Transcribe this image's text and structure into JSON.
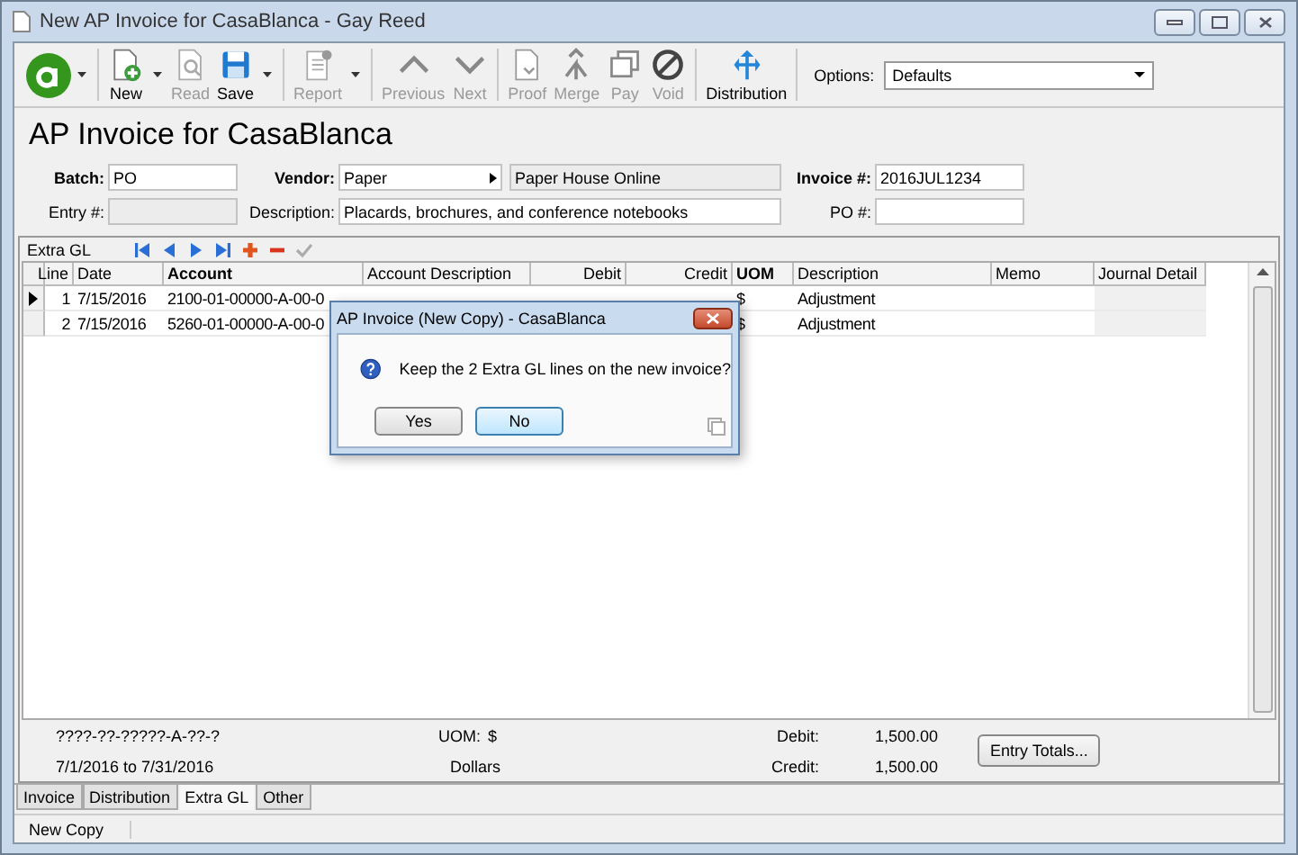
{
  "window": {
    "title": "New AP Invoice for CasaBlanca - Gay Reed"
  },
  "toolbar": {
    "groups": [
      {
        "items": [
          {
            "kind": "logo",
            "disabled": false,
            "menu": true
          }
        ]
      },
      {
        "items": [
          {
            "kind": "button",
            "label": "New",
            "disabled": false,
            "menu": true
          },
          {
            "kind": "button",
            "label": "Read",
            "disabled": true,
            "menu": false
          },
          {
            "kind": "button",
            "label": "Save",
            "disabled": false,
            "menu": true
          }
        ]
      },
      {
        "items": [
          {
            "kind": "button",
            "label": "Report",
            "disabled": true,
            "menu": true
          }
        ]
      },
      {
        "items": [
          {
            "kind": "button",
            "label": "Previous",
            "disabled": true,
            "menu": false
          },
          {
            "kind": "button",
            "label": "Next",
            "disabled": true,
            "menu": false
          }
        ]
      },
      {
        "items": [
          {
            "kind": "button",
            "label": "Proof",
            "disabled": true,
            "menu": false
          },
          {
            "kind": "button",
            "label": "Merge",
            "disabled": true,
            "menu": false
          },
          {
            "kind": "button",
            "label": "Pay",
            "disabled": true,
            "menu": false
          },
          {
            "kind": "button",
            "label": "Void",
            "disabled": true,
            "menu": false
          }
        ]
      },
      {
        "items": [
          {
            "kind": "button",
            "label": "Distribution",
            "disabled": false,
            "menu": false
          }
        ]
      }
    ],
    "options": {
      "label": "Options:",
      "value": "Defaults"
    }
  },
  "heading": "AP Invoice for CasaBlanca",
  "fields": {
    "batch": {
      "label": "Batch:",
      "value": "PO"
    },
    "vendor": {
      "label": "Vendor:",
      "value": "Paper",
      "name": "Paper House Online"
    },
    "invoice": {
      "label": "Invoice #:",
      "value": "2016JUL1234"
    },
    "entry": {
      "label": "Entry #:"
    },
    "description": {
      "label": "Description:",
      "value": "Placards, brochures, and conference notebooks"
    },
    "po": {
      "label": "PO #:"
    }
  },
  "extra_gl": {
    "label": "Extra GL",
    "nav_disabled": [
      false,
      false,
      false,
      false,
      false,
      false,
      true
    ]
  },
  "table": {
    "columns": [
      {
        "label": "Line",
        "bold": false,
        "kind": "number"
      },
      {
        "label": "Date",
        "bold": false,
        "kind": "text"
      },
      {
        "label": "Account",
        "bold": true,
        "kind": "text"
      },
      {
        "label": "Account Description",
        "bold": false,
        "kind": "text"
      },
      {
        "label": "Debit",
        "bold": false,
        "kind": "number"
      },
      {
        "label": "Credit",
        "bold": false,
        "kind": "number"
      },
      {
        "label": "UOM",
        "bold": true,
        "kind": "text"
      },
      {
        "label": "Description",
        "bold": false,
        "kind": "text"
      },
      {
        "label": "Memo",
        "bold": false,
        "kind": "text"
      },
      {
        "label": "Journal Detail",
        "bold": false,
        "kind": "readonly"
      }
    ],
    "rows": [
      {
        "selected": true,
        "line": "1",
        "date": "7/15/2016",
        "account": "2100-01-00000-A-00-0",
        "uom": "$",
        "description": "Adjustment"
      },
      {
        "selected": false,
        "line": "2",
        "date": "7/15/2016",
        "account": "5260-01-00000-A-00-0",
        "uom": "$",
        "description": "Adjustment"
      }
    ]
  },
  "footer": {
    "account_mask": "????-??-?????-A-??-?",
    "period": "7/1/2016 to 7/31/2016",
    "uom_label": "UOM:",
    "uom": "$",
    "uom_name": "Dollars",
    "debit_label": "Debit:",
    "debit": "1,500.00",
    "credit_label": "Credit:",
    "credit": "1,500.00",
    "totals_button": "Entry Totals..."
  },
  "tabs": [
    {
      "label": "Invoice",
      "selected": false
    },
    {
      "label": "Distribution",
      "selected": false
    },
    {
      "label": "Extra GL",
      "selected": true
    },
    {
      "label": "Other",
      "selected": false
    }
  ],
  "status_bar": "New Copy",
  "dialog": {
    "title": "AP Invoice (New Copy) - CasaBlanca",
    "message": "Keep the 2 Extra GL lines on the new invoice?",
    "buttons": [
      {
        "label": "Yes",
        "focused": false
      },
      {
        "label": "No",
        "focused": true
      }
    ]
  }
}
